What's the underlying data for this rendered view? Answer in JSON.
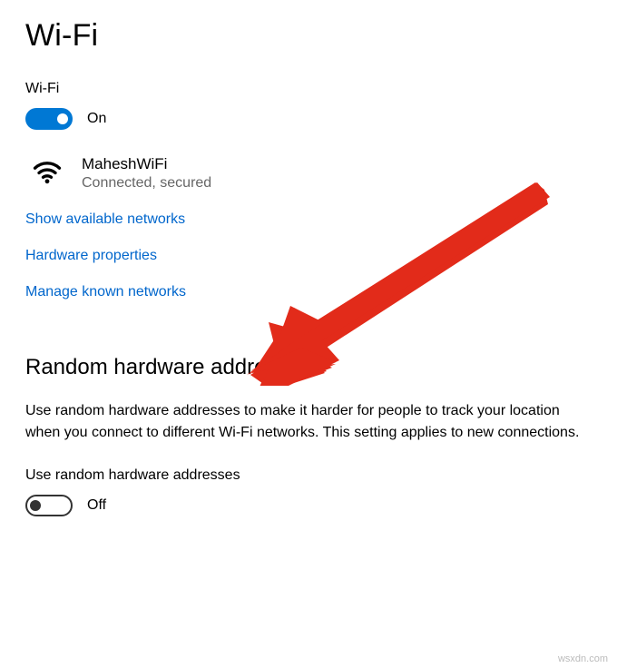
{
  "page": {
    "title": "Wi-Fi"
  },
  "wifi_toggle": {
    "label": "Wi-Fi",
    "state_text": "On",
    "on": true
  },
  "network": {
    "name": "MaheshWiFi",
    "status": "Connected, secured"
  },
  "links": {
    "show_available": "Show available networks",
    "hardware_props": "Hardware properties",
    "manage_known": "Manage known networks"
  },
  "random_hw": {
    "heading": "Random hardware addresses",
    "description": "Use random hardware addresses to make it harder for people to track your location when you connect to different Wi-Fi networks. This setting applies to new connections.",
    "toggle_label": "Use random hardware addresses",
    "state_text": "Off",
    "on": false
  },
  "watermark": "wsxdn.com"
}
